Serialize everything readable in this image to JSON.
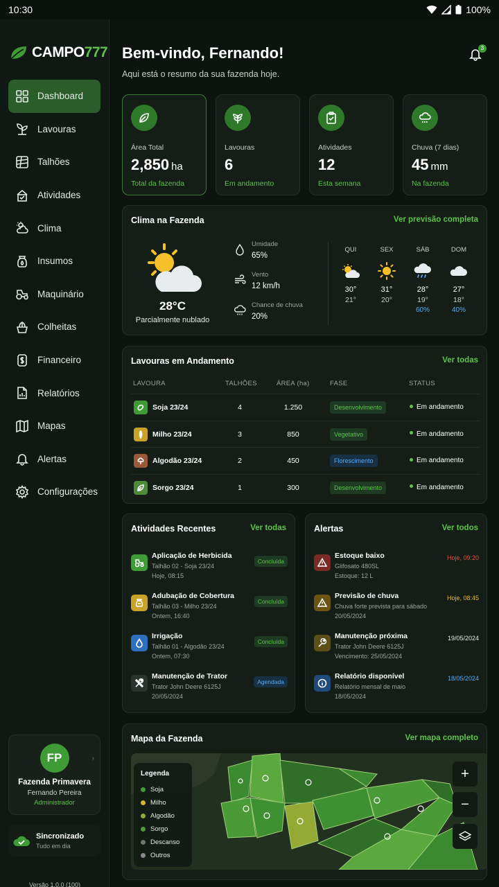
{
  "status_bar": {
    "time": "10:30",
    "battery": "100%"
  },
  "brand": {
    "name_part1": "CAMPO",
    "name_part2": "777"
  },
  "sidebar": {
    "items": [
      {
        "label": "Dashboard",
        "icon": "grid-icon"
      },
      {
        "label": "Lavouras",
        "icon": "sprout-icon"
      },
      {
        "label": "Talhões",
        "icon": "field-icon"
      },
      {
        "label": "Atividades",
        "icon": "tasks-icon"
      },
      {
        "label": "Clima",
        "icon": "cloud-sun-icon"
      },
      {
        "label": "Insumos",
        "icon": "bag-icon"
      },
      {
        "label": "Maquinário",
        "icon": "tractor-icon"
      },
      {
        "label": "Colheitas",
        "icon": "harvest-icon"
      },
      {
        "label": "Financeiro",
        "icon": "money-icon"
      },
      {
        "label": "Relatórios",
        "icon": "report-icon"
      },
      {
        "label": "Mapas",
        "icon": "map-icon"
      },
      {
        "label": "Alertas",
        "icon": "bell-icon"
      },
      {
        "label": "Configurações",
        "icon": "gear-icon"
      }
    ],
    "user": {
      "initials": "FP",
      "farm": "Fazenda Primavera",
      "name": "Fernando Pereira",
      "role": "Administrador"
    },
    "sync": {
      "title": "Sincronizado",
      "subtitle": "Tudo em dia"
    },
    "version": "Versão 1.0.0 (100)"
  },
  "header": {
    "title": "Bem-vindo, Fernando!",
    "subtitle": "Aqui está o resumo da sua fazenda hoje.",
    "notification_count": "3"
  },
  "stats": [
    {
      "label": "Área Total",
      "value": "2,850",
      "unit": "ha",
      "sub": "Total da fazenda"
    },
    {
      "label": "Lavouras",
      "value": "6",
      "unit": "",
      "sub": "Em andamento"
    },
    {
      "label": "Atividades",
      "value": "12",
      "unit": "",
      "sub": "Esta semana"
    },
    {
      "label": "Chuva (7 dias)",
      "value": "45",
      "unit": "mm",
      "sub": "Na fazenda"
    }
  ],
  "weather": {
    "title": "Clima na Fazenda",
    "link": "Ver previsão completa",
    "temp": "28°C",
    "desc": "Parcialmente nublado",
    "humidity_label": "Umidade",
    "humidity": "65%",
    "wind_label": "Vento",
    "wind": "12 km/h",
    "rain_label": "Chance de chuva",
    "rain": "20%",
    "forecast": [
      {
        "day": "QUI",
        "icon": "partly-cloudy-icon",
        "max": "30°",
        "min": "21°",
        "rain": ""
      },
      {
        "day": "SEX",
        "icon": "sun-icon",
        "max": "31°",
        "min": "20°",
        "rain": ""
      },
      {
        "day": "SÁB",
        "icon": "rain-cloud-icon",
        "max": "28°",
        "min": "19°",
        "rain": "60%"
      },
      {
        "day": "DOM",
        "icon": "cloud-icon",
        "max": "27°",
        "min": "18°",
        "rain": "40%"
      }
    ]
  },
  "crops": {
    "title": "Lavouras em Andamento",
    "link": "Ver todas",
    "headers": [
      "LAVOURA",
      "TALHÕES",
      "ÁREA (ha)",
      "FASE",
      "STATUS"
    ],
    "rows": [
      {
        "name": "Soja 23/24",
        "plots": "4",
        "area": "1.250",
        "phase": "Desenvolvimento",
        "status": "Em andamento",
        "color": "#3e9b35"
      },
      {
        "name": "Milho 23/24",
        "plots": "3",
        "area": "850",
        "phase": "Vegetativo",
        "status": "Em andamento",
        "color": "#c9a227"
      },
      {
        "name": "Algodão 23/24",
        "plots": "2",
        "area": "450",
        "phase": "Florescimento",
        "status": "Em andamento",
        "color": "#9a5a3a"
      },
      {
        "name": "Sorgo 23/24",
        "plots": "1",
        "area": "300",
        "phase": "Desenvolvimento",
        "status": "Em andamento",
        "color": "#4f8a3a"
      }
    ]
  },
  "activities": {
    "title": "Atividades Recentes",
    "link": "Ver todas",
    "items": [
      {
        "title": "Aplicação de Herbicida",
        "l2": "Talhão 02 - Soja 23/24",
        "l3": "Hoje, 08:15",
        "badge": "Concluída",
        "icon": "tractor-icon"
      },
      {
        "title": "Adubação de Cobertura",
        "l2": "Talhão 03 - Milho 23/24",
        "l3": "Ontem, 16:40",
        "badge": "Concluída",
        "icon": "fertilizer-icon"
      },
      {
        "title": "Irrigação",
        "l2": "Talhão 01 - Algodão 23/24",
        "l3": "Ontem, 07:30",
        "badge": "Concluída",
        "icon": "water-drop-icon"
      },
      {
        "title": "Manutenção de Trator",
        "l2": "Trator John Deere 6125J",
        "l3": "20/05/2024",
        "badge": "Agendada",
        "icon": "tools-icon"
      }
    ]
  },
  "alerts": {
    "title": "Alertas",
    "link": "Ver todos",
    "items": [
      {
        "title": "Estoque baixo",
        "l2": "Glifosato 480SL",
        "l3": "Estoque: 12 L",
        "time": "Hoje, 09:20",
        "time_color": "#e0533d",
        "icon": "warning-icon"
      },
      {
        "title": "Previsão de chuva",
        "l2": "Chuva forte prevista para sábado",
        "l3": "20/05/2024",
        "time": "Hoje, 08:45",
        "time_color": "#e8b92e",
        "icon": "warning-icon"
      },
      {
        "title": "Manutenção próxima",
        "l2": "Trator John Deere 6125J",
        "l3": "Vencimento: 25/05/2024",
        "time": "19/05/2024",
        "time_color": "#e4ebe5",
        "icon": "wrench-icon"
      },
      {
        "title": "Relatório disponível",
        "l2": "Relatório mensal de maio",
        "l3": "18/05/2024",
        "time": "18/05/2024",
        "time_color": "#59a9f3",
        "icon": "info-icon"
      }
    ]
  },
  "map": {
    "title": "Mapa da Fazenda",
    "link": "Ver mapa completo",
    "legend_title": "Legenda",
    "legend": [
      {
        "label": "Soja",
        "color": "#3e9b35"
      },
      {
        "label": "Milho",
        "color": "#d4b52b"
      },
      {
        "label": "Algodão",
        "color": "#8fae3c"
      },
      {
        "label": "Sorgo",
        "color": "#4f9a3a"
      },
      {
        "label": "Descanso",
        "color": "#6b7a6b"
      },
      {
        "label": "Outros",
        "color": "#8a8a8a"
      }
    ],
    "zoom_in": "+",
    "zoom_out": "−"
  }
}
